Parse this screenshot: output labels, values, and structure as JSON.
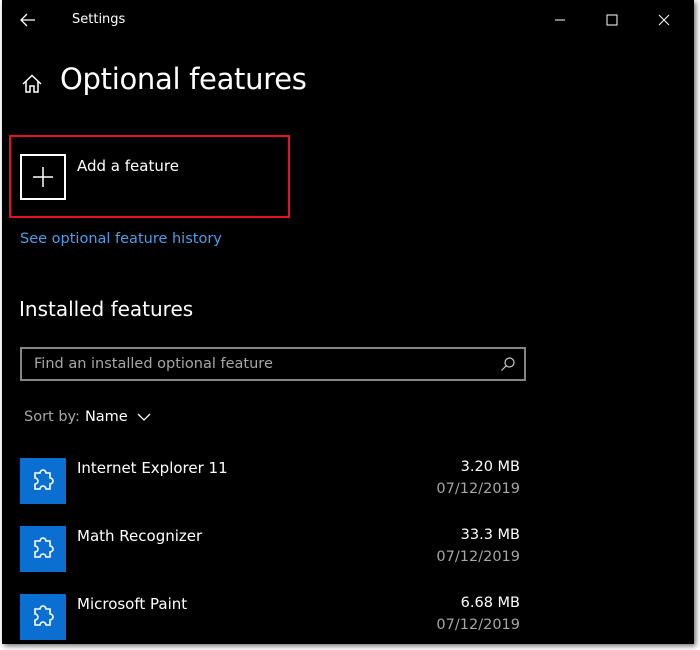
{
  "window": {
    "title": "Settings"
  },
  "icons": {
    "back": "back-arrow-icon",
    "minimize": "minimize-icon",
    "maximize": "maximize-icon",
    "close": "close-icon",
    "home": "home-icon",
    "add": "plus-icon",
    "search": "search-icon",
    "sort": "chevron-down-icon",
    "feature": "puzzle-piece-icon"
  },
  "colors": {
    "background": "#000000",
    "accent": "#0b6fd1",
    "link": "#4a9eea",
    "highlight": "#e81123"
  },
  "page": {
    "title": "Optional features"
  },
  "add_feature": {
    "label": "Add a feature"
  },
  "history_link": "See optional feature history",
  "installed": {
    "heading": "Installed features",
    "search_placeholder": "Find an installed optional feature",
    "sort_label": "Sort by:",
    "sort_value": "Name",
    "items": [
      {
        "name": "Internet Explorer 11",
        "size": "3.20 MB",
        "date": "07/12/2019"
      },
      {
        "name": "Math Recognizer",
        "size": "33.3 MB",
        "date": "07/12/2019"
      },
      {
        "name": "Microsoft Paint",
        "size": "6.68 MB",
        "date": "07/12/2019"
      }
    ]
  }
}
